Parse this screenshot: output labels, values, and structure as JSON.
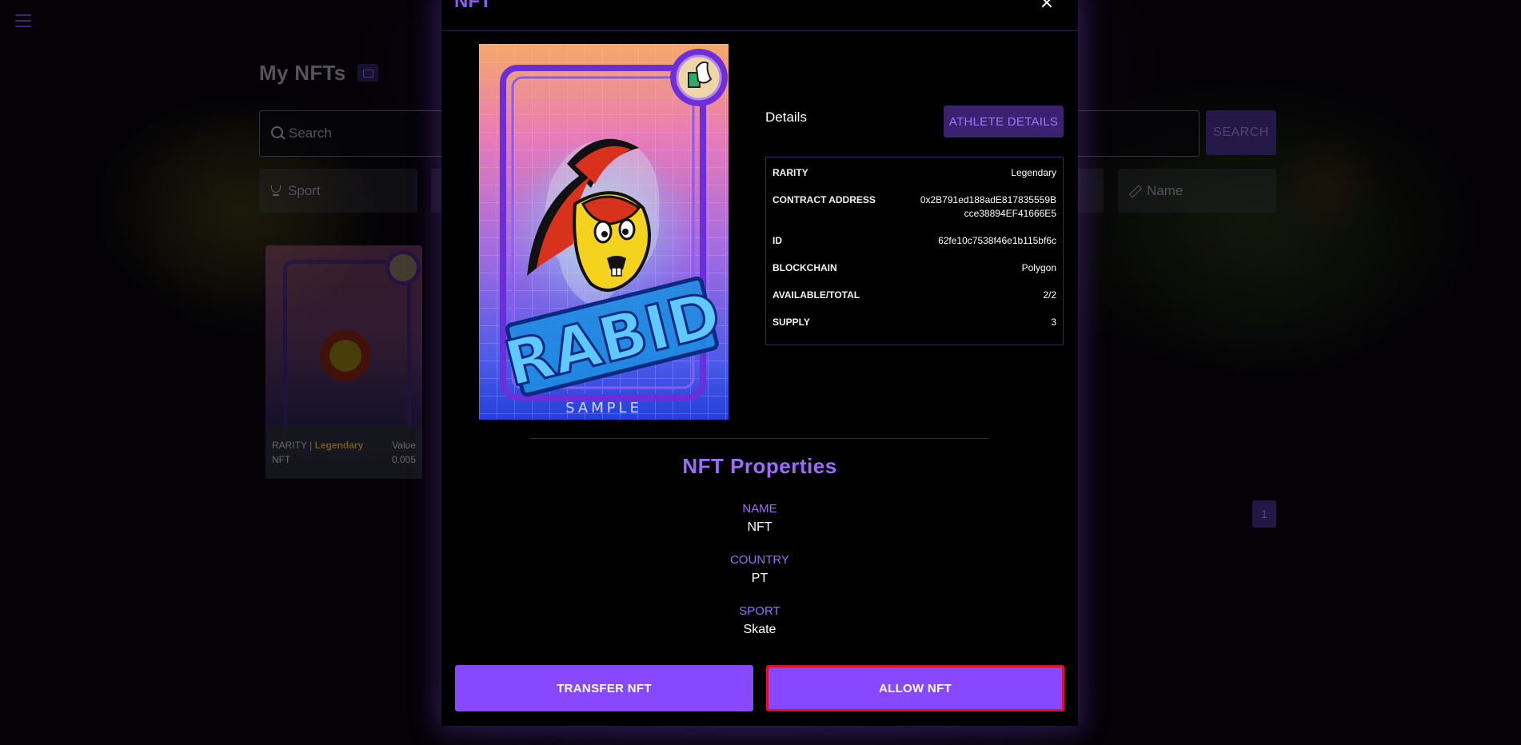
{
  "sidebar": {
    "menu_icon": "hamburger-icon"
  },
  "page": {
    "title": "My NFTs",
    "title_icon": "image-icon",
    "search": {
      "placeholder": "Search",
      "button_label": "SEARCH"
    },
    "filters": [
      {
        "label": "Sport",
        "icon": "trophy-icon"
      },
      {
        "label": "Name",
        "icon": "pencil-icon"
      }
    ],
    "nft_card": {
      "rarity_label": "RARITY",
      "rarity_value": "Legendary",
      "name": "NFT",
      "value_label": "Value",
      "value": "0.005"
    },
    "pagination": {
      "current": "1"
    }
  },
  "modal": {
    "title": "NFT",
    "close_icon": "close-icon",
    "card_art": {
      "watermark": "SAMPLE",
      "logo_text": "RABID"
    },
    "details": {
      "title": "Details",
      "athlete_button": "ATHLETE DETAILS",
      "rows": [
        {
          "label": "RARITY",
          "value": "Legendary"
        },
        {
          "label": "CONTRACT ADDRESS",
          "value_line1": "0x2B791ed188adE817835559B",
          "value_line2": "cce38894EF41666E5"
        },
        {
          "label": "ID",
          "value": "62fe10c7538f46e1b115bf6c"
        },
        {
          "label": "BLOCKCHAIN",
          "value": "Polygon"
        },
        {
          "label": "AVAILABLE/TOTAL",
          "value": "2/2"
        },
        {
          "label": "SUPPLY",
          "value": "3"
        }
      ]
    },
    "properties": {
      "title": "NFT Properties",
      "items": [
        {
          "label": "NAME",
          "value": "NFT"
        },
        {
          "label": "COUNTRY",
          "value": "PT"
        },
        {
          "label": "SPORT",
          "value": "Skate"
        }
      ]
    },
    "actions": {
      "transfer": "TRANSFER NFT",
      "allow": "ALLOW NFT"
    }
  },
  "colors": {
    "accent": "#8848ff",
    "accent_text": "#9d6bff",
    "highlight_border": "#e0102a",
    "legendary": "#c19a2f"
  }
}
